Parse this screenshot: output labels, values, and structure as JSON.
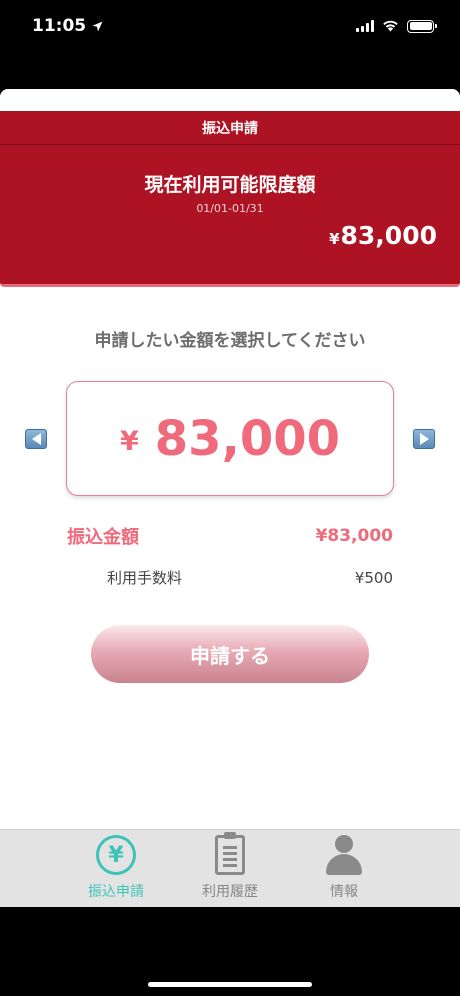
{
  "status_bar": {
    "time": "11:05",
    "location_icon": "location-arrow-icon",
    "signal_icon": "cellular-signal-icon",
    "wifi_icon": "wifi-icon",
    "battery_icon": "battery-icon"
  },
  "header": {
    "title": "振込申請",
    "limit_title": "現在利用可能限度額",
    "period": "01/01-01/31",
    "limit_currency": "¥",
    "limit_amount": "83,000",
    "background_color": "#ad1323"
  },
  "main": {
    "prompt": "申請したい金額を選択してください",
    "selector": {
      "currency": "¥",
      "amount": "83,000",
      "prev_icon": "arrow-left-icon",
      "next_icon": "arrow-right-icon"
    },
    "transfer_label": "振込金額",
    "transfer_value": "¥83,000",
    "fee_label": "利用手数料",
    "fee_value": "¥500",
    "submit_label": "申請する",
    "accent_color": "#ef6a7b"
  },
  "tab_bar": {
    "active_color": "#3ec3b8",
    "tabs": [
      {
        "label": "振込申請",
        "icon": "yen-circle-icon",
        "active": true
      },
      {
        "label": "利用履歴",
        "icon": "clipboard-icon",
        "active": false
      },
      {
        "label": "情報",
        "icon": "person-icon",
        "active": false
      }
    ]
  }
}
